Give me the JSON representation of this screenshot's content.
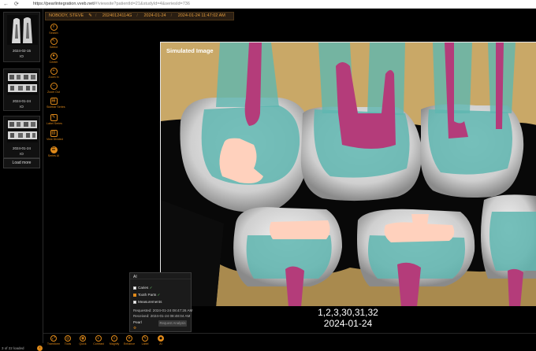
{
  "browser": {
    "nav_back": "←",
    "nav_refresh": "⟳",
    "url_host": "https://pearlintegration.vveb.net/",
    "url_rest": "#!viewsite?patientId=21&studyId=4&seriesId=736"
  },
  "studies": [
    {
      "date": "2024-02-15",
      "site": "IO"
    },
    {
      "date": "2024-01-24",
      "site": "IO"
    },
    {
      "date": "2024-01-24",
      "site": "IO"
    }
  ],
  "load_more": "Load more",
  "loaded_count": "3 of 22 loaded",
  "patient_header": {
    "name": "NOBODY, STEVE",
    "patient_id": "20240124114G",
    "study_date": "2024-01-24",
    "study_datetime": "2024-01-24 11:47:02 AM"
  },
  "tools": [
    {
      "label": "Search",
      "icon": "search-icon"
    },
    {
      "label": "Select",
      "icon": "cursor-icon"
    },
    {
      "label": "Center",
      "icon": "target-icon"
    },
    {
      "label": "Zoom In",
      "icon": "zoom-in-icon"
    },
    {
      "label": "Zoom Out",
      "icon": "zoom-out-icon"
    },
    {
      "label": "Sidebar Series",
      "icon": "sidebar-icon"
    },
    {
      "label": "Label Series",
      "icon": "label-icon"
    },
    {
      "label": "View Divided",
      "icon": "split-icon"
    },
    {
      "label": "Series AI",
      "icon": "ai-icon"
    }
  ],
  "viewer": {
    "title": "Simulated Image",
    "teeth_numbers": "1,2,3,30,31,32",
    "image_date": "2024-01-24"
  },
  "ai_panel": {
    "title": "AI",
    "caries_label": "Caries",
    "tooth_parts_label": "Tooth Parts",
    "measurements_label": "Measurements",
    "check_mark": "✓",
    "requested": "Requested: 2024-01-24 08:47:26 AM",
    "received": "Received: 2024-01-24 08:48:04 AM",
    "provider": "Pearl",
    "provider_flag": "⚙",
    "request_button": "Request Analysis"
  },
  "bottom_tools": [
    {
      "label": "Transform",
      "icon": "transform-icon"
    },
    {
      "label": "Tools",
      "icon": "tools-icon"
    },
    {
      "label": "Quick",
      "icon": "quick-icon"
    },
    {
      "label": "Contrast",
      "icon": "contrast-icon"
    },
    {
      "label": "Magnify",
      "icon": "magnify-icon"
    },
    {
      "label": "Enhance",
      "icon": "enhance-icon"
    },
    {
      "label": "Label",
      "icon": "label-icon"
    },
    {
      "label": "AI",
      "icon": "ai-icon"
    }
  ],
  "colors": {
    "accent": "#e08a1a",
    "enamel_teal": "#5fb6b0",
    "pulp_magenta": "#b43c7a",
    "bone_tan": "#c9a867",
    "restoration_peach": "#ffd1bd"
  }
}
